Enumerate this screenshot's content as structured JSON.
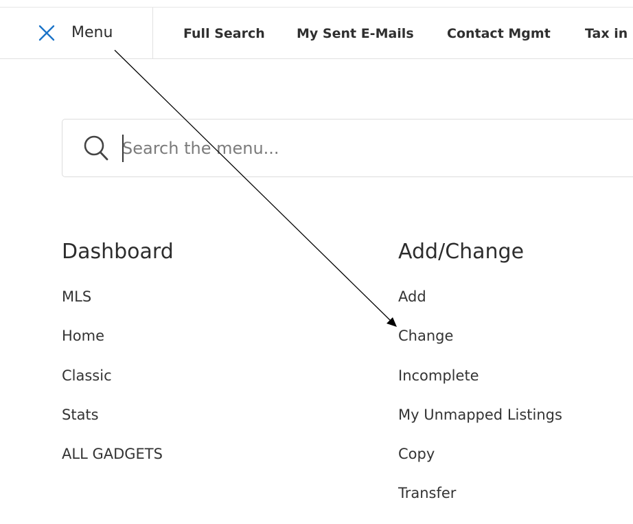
{
  "topbar": {
    "menu_label": "Menu",
    "tabs": [
      {
        "label": "Full Search"
      },
      {
        "label": "My Sent E-Mails"
      },
      {
        "label": "Contact Mgmt"
      },
      {
        "label": "Tax in"
      }
    ]
  },
  "search": {
    "placeholder": "Search the menu...",
    "value": ""
  },
  "columns": [
    {
      "title": "Dashboard",
      "items": [
        "MLS",
        "Home",
        "Classic",
        "Stats",
        "ALL GADGETS"
      ]
    },
    {
      "title": "Add/Change",
      "items": [
        "Add",
        "Change",
        "Incomplete",
        "My Unmapped Listings",
        "Copy",
        "Transfer"
      ]
    }
  ],
  "colors": {
    "accent": "#1a73c8",
    "text": "#333333",
    "border": "#dcdcdc"
  },
  "icons": [
    "close-icon",
    "search-icon"
  ]
}
